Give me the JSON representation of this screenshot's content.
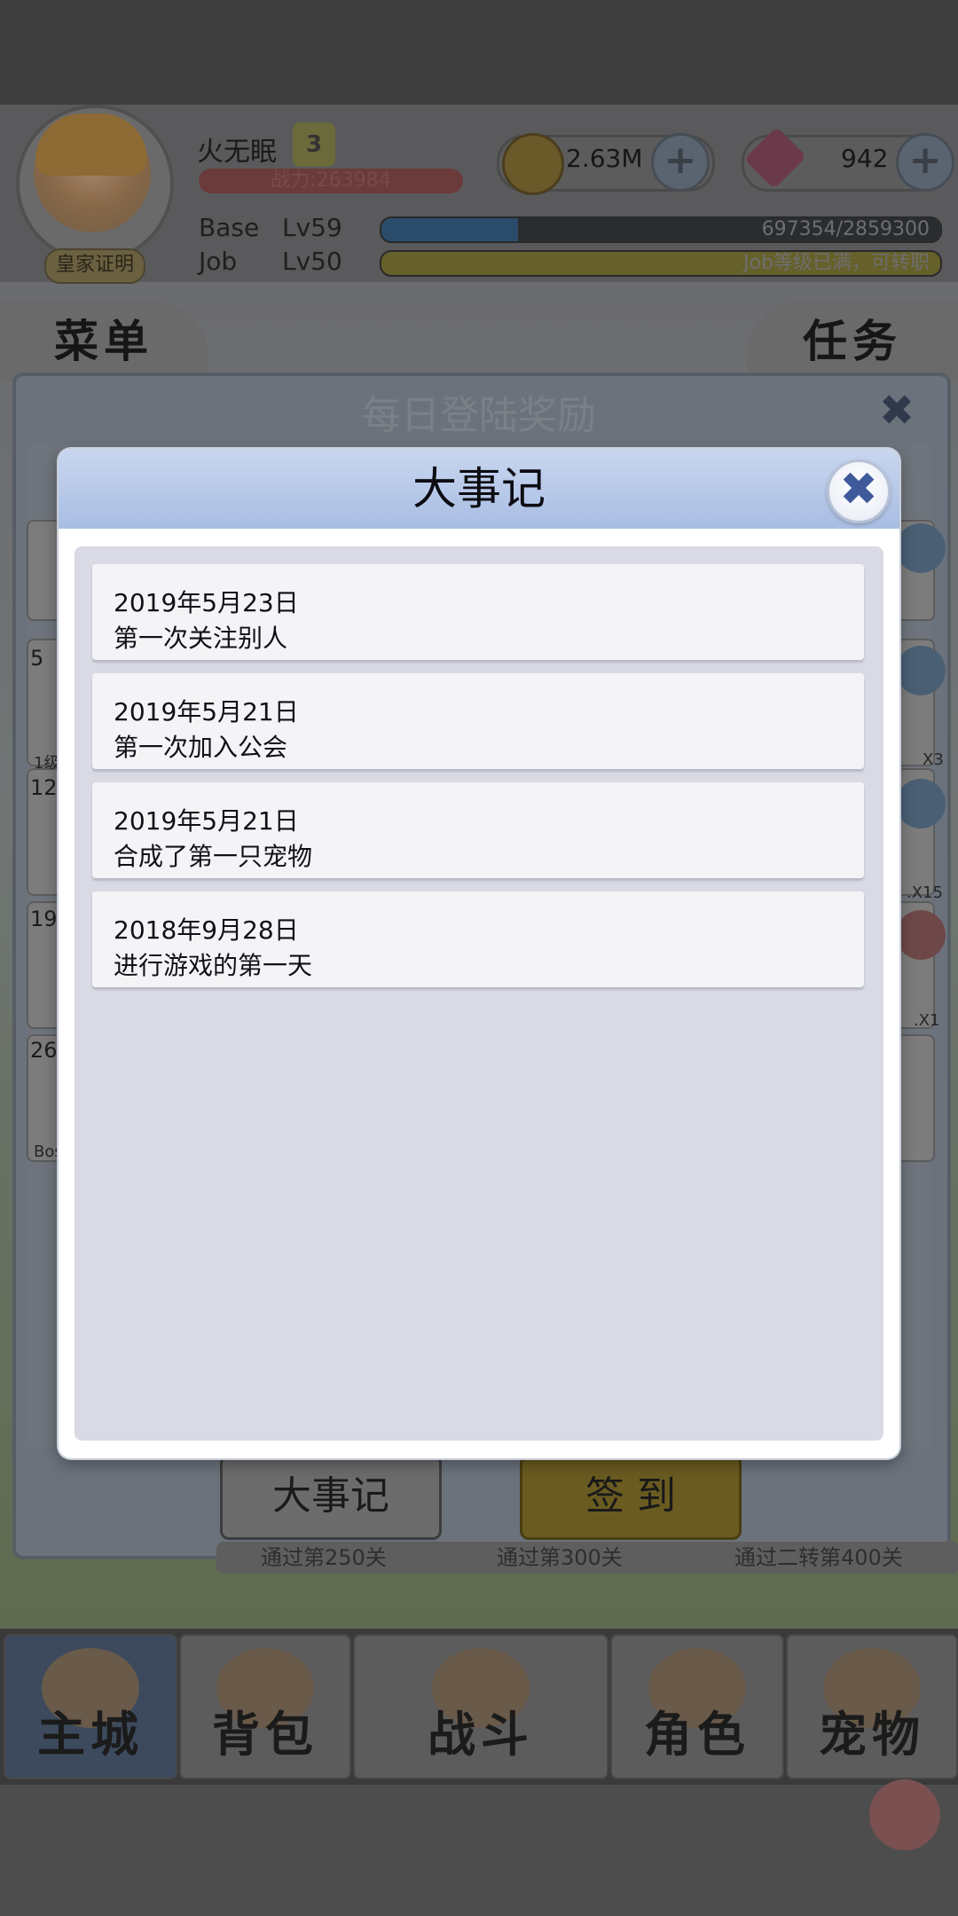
{
  "player": {
    "name": "火无眠",
    "vip_level": "3",
    "power_text": "战力:263984",
    "badge_text": "皇家证明",
    "base_label": "Base",
    "base_level": "Lv59",
    "base_xp_text": "697354/2859300",
    "base_progress": 0.2439,
    "job_label": "Job",
    "job_level": "Lv50",
    "job_xp_text": "Job等级已满，可转职"
  },
  "resources": {
    "zeny": "2.63M",
    "gems": "942",
    "plus": "+"
  },
  "side_tabs": {
    "menu": "菜单",
    "quest": "任务"
  },
  "daily_dialog": {
    "title": "每日登陆奖励",
    "close": "✖",
    "left_numbers": [
      "5",
      "12",
      "19",
      "26"
    ],
    "left_labels": [
      "1级",
      "Bos"
    ],
    "right_labels": [
      "X3",
      ".X15",
      ".X1"
    ],
    "history_button": "大事记",
    "signin_button": "签 到",
    "stage_labels": [
      "通过第250关",
      "通过第300关",
      "通过二转第400关"
    ]
  },
  "modal": {
    "title": "大事记",
    "close": "✖",
    "events": [
      {
        "date": "2019年5月23日",
        "desc": "第一次关注别人"
      },
      {
        "date": "2019年5月21日",
        "desc": "第一次加入公会"
      },
      {
        "date": "2019年5月21日",
        "desc": "合成了第一只宠物"
      },
      {
        "date": "2018年9月28日",
        "desc": "进行游戏的第一天"
      }
    ]
  },
  "bottom_nav": [
    {
      "label": "主城",
      "icon": "castle-icon",
      "active": true
    },
    {
      "label": "背包",
      "icon": "backpack-icon",
      "active": false
    },
    {
      "label": "战斗",
      "icon": "battle-icon",
      "active": false
    },
    {
      "label": "角色",
      "icon": "character-icon",
      "active": false
    },
    {
      "label": "宠物",
      "icon": "pet-icon",
      "active": false
    }
  ]
}
